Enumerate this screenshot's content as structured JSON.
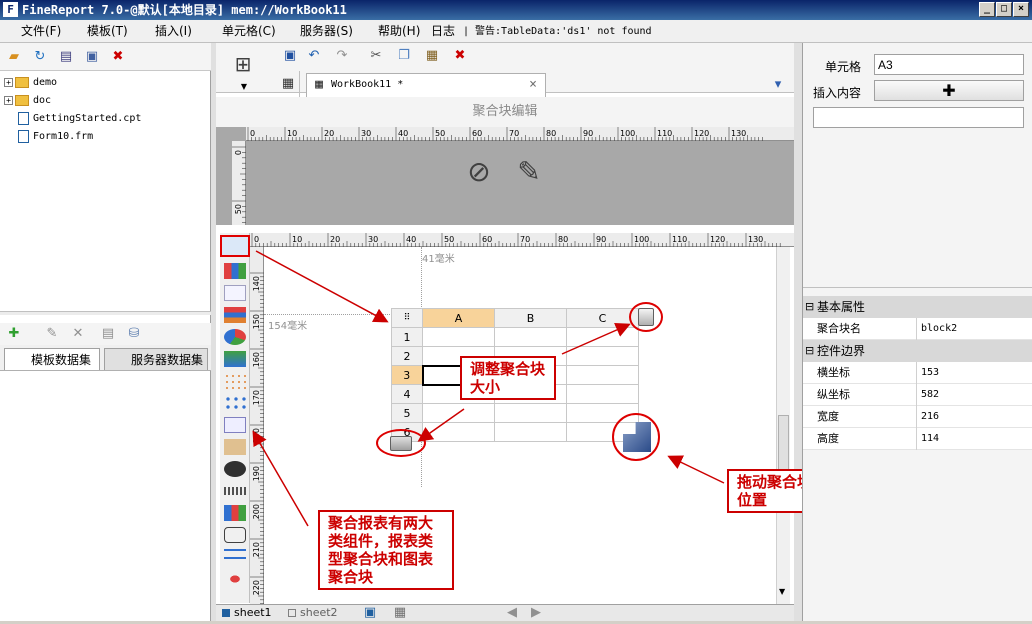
{
  "window": {
    "title": "FineReport 7.0-@默认[本地目录]    mem://WorkBook11",
    "logo_text": "F"
  },
  "menu": [
    "文件(F)",
    "模板(T)",
    "插入(I)",
    "单元格(C)",
    "服务器(S)",
    "帮助(H)",
    "日志",
    "| 警告:TableData:'ds1' not found"
  ],
  "tree": [
    {
      "label": "demo",
      "type": "folder"
    },
    {
      "label": "doc",
      "type": "folder"
    },
    {
      "label": "GettingStarted.cpt",
      "type": "file"
    },
    {
      "label": "Form10.frm",
      "type": "file"
    }
  ],
  "dataset_tabs": [
    "模板数据集",
    "服务器数据集"
  ],
  "editor": {
    "tab_label": "WorkBook11 *",
    "section_title": "聚合块编辑",
    "ruler_h_top": [
      "0",
      "10",
      "20",
      "30",
      "40",
      "50",
      "60",
      "70",
      "80",
      "90",
      "100",
      "110",
      "120",
      "130"
    ],
    "ruler_v_top": [
      "0",
      "50"
    ],
    "ruler_h_design": [
      "0",
      "10",
      "20",
      "30",
      "40",
      "50",
      "60",
      "70",
      "80",
      "90",
      "100",
      "110",
      "120",
      "130"
    ],
    "ruler_v_design": [
      "140",
      "150",
      "160",
      "170",
      "180",
      "190",
      "200",
      "210",
      "220"
    ],
    "guide_x_label": "41毫米",
    "guide_y_label": "154毫米"
  },
  "grid": {
    "columns": [
      "A",
      "B",
      "C"
    ],
    "rows": [
      "1",
      "2",
      "3",
      "4",
      "5",
      "6"
    ]
  },
  "sheets": [
    "sheet1",
    "sheet2"
  ],
  "properties": {
    "cell_label": "单元格",
    "cell_value": "A3",
    "insert_label": "插入内容",
    "group_basic": "基本属性",
    "block_name_label": "聚合块名",
    "block_name_value": "block2",
    "group_bounds": "控件边界",
    "x_label": "横坐标",
    "x_value": "153",
    "y_label": "纵坐标",
    "y_value": "582",
    "w_label": "宽度",
    "w_value": "216",
    "h_label": "高度",
    "h_value": "114"
  },
  "callouts": {
    "resize": "调整聚合块大小",
    "components": "聚合报表有两大类组件，报表类型聚合块和图表聚合块",
    "move": "拖动聚合块位置"
  },
  "colors": {
    "annotation": "#cc0000",
    "selected_header": "#f8d39a",
    "title_bar": "#0a246a"
  }
}
